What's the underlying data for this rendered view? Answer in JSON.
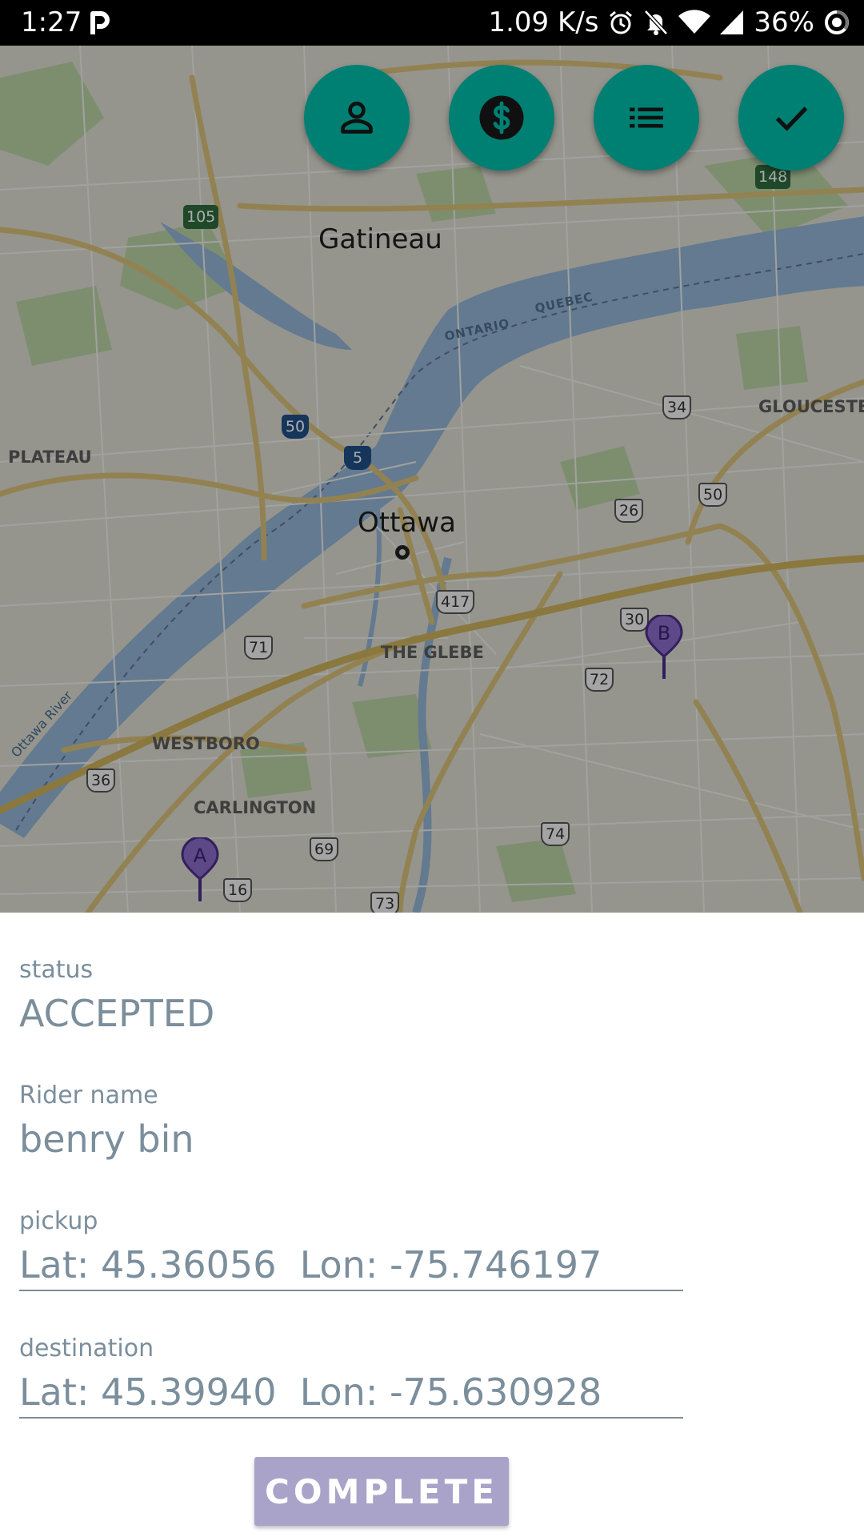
{
  "status_bar": {
    "time": "1:27",
    "network_speed": "1.09 K/s",
    "battery": "36%",
    "icons": [
      "parking-app-icon",
      "alarm-icon",
      "notifications-off-icon",
      "wifi-icon",
      "cell-signal-icon",
      "battery-icon"
    ]
  },
  "map": {
    "cities": {
      "gatineau": "Gatineau",
      "ottawa": "Ottawa"
    },
    "districts": {
      "plateau": "PLATEAU",
      "gloucester": "GLOUCESTER",
      "the_glebe": "THE GLEBE",
      "westboro": "WESTBORO",
      "carlington": "CARLINGTON"
    },
    "borders": {
      "ontario": "ONTARIO",
      "quebec": "QUEBEC"
    },
    "river": "Ottawa River",
    "route_shields": {
      "r105": "105",
      "r148": "148",
      "r50a": "50",
      "r5": "5",
      "r34": "34",
      "r50b": "50",
      "r26": "26",
      "r417": "417",
      "r30": "30",
      "r71": "71",
      "r72": "72",
      "r36": "36",
      "r74": "74",
      "r69": "69",
      "r16": "16",
      "r73": "73"
    },
    "markers": {
      "pickup": "A",
      "destination": "B"
    }
  },
  "fabs": {
    "colors": {
      "fab": "#007f73"
    },
    "items": [
      "person-icon",
      "dollar-icon",
      "list-icon",
      "check-icon"
    ]
  },
  "details": {
    "status": {
      "label": "status",
      "value": "ACCEPTED"
    },
    "rider": {
      "label": "Rider name",
      "value": "benry bin"
    },
    "pickup": {
      "label": "pickup",
      "value": "Lat: 45.36056  Lon: -75.746197"
    },
    "destination": {
      "label": "destination",
      "value": "Lat: 45.39940  Lon: -75.630928"
    }
  },
  "complete_button": {
    "label": "COMPLETE",
    "color": "#a9a3c9"
  }
}
